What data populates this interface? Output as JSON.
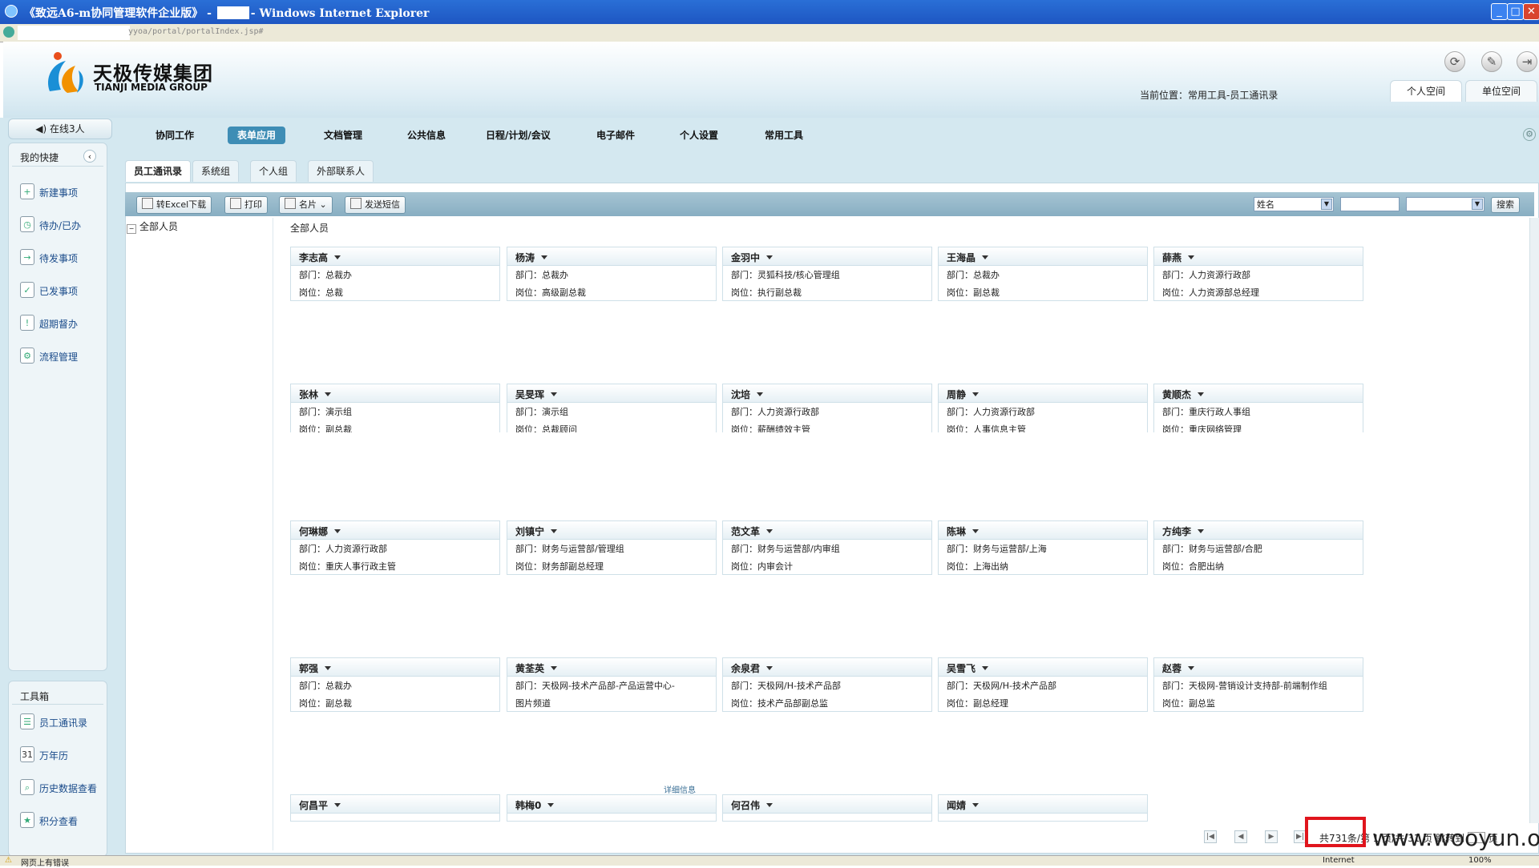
{
  "window": {
    "title": "《致远A6-m协同管理软件企业版》 - ",
    "title_suffix": "- Windows Internet Explorer"
  },
  "address": {
    "url": "yyoa/portal/portalIndex.jsp#"
  },
  "brand": {
    "name_cn": "天极传媒集团",
    "name_en": "TIANJI MEDIA GROUP"
  },
  "header": {
    "location": "当前位置：常用工具-员工通讯录",
    "tabs": [
      "个人空间",
      "单位空间"
    ]
  },
  "sidebar": {
    "online": "在线3人",
    "quick_title": "我的快捷",
    "quick_items": [
      {
        "label": "新建事项",
        "icon": "new-item-icon"
      },
      {
        "label": "待办/已办",
        "icon": "todo-icon"
      },
      {
        "label": "待发事项",
        "icon": "pending-send-icon"
      },
      {
        "label": "已发事项",
        "icon": "sent-icon"
      },
      {
        "label": "超期督办",
        "icon": "overdue-icon"
      },
      {
        "label": "流程管理",
        "icon": "workflow-icon"
      }
    ],
    "toolbox_title": "工具箱",
    "toolbox_items": [
      {
        "label": "员工通讯录",
        "icon": "address-book-icon"
      },
      {
        "label": "万年历",
        "icon": "calendar-icon",
        "glyph": "31"
      },
      {
        "label": "历史数据查看",
        "icon": "history-icon"
      },
      {
        "label": "积分查看",
        "icon": "points-icon"
      }
    ]
  },
  "nav": {
    "items": [
      "协同工作",
      "表单应用",
      "文档管理",
      "公共信息",
      "日程/计划/会议",
      "电子邮件",
      "个人设置",
      "常用工具"
    ],
    "active": "表单应用"
  },
  "subtabs": {
    "items": [
      "员工通讯录",
      "系统组",
      "个人组",
      "外部联系人"
    ],
    "active": "员工通讯录"
  },
  "toolbar": {
    "excel": "转Excel下载",
    "print": "打印",
    "card": "名片",
    "sms": "发送短信",
    "search_field": "姓名",
    "search_button": "搜索"
  },
  "tree": {
    "root": "全部人员"
  },
  "group_label": "全部人员",
  "cards": [
    {
      "name": "李志高",
      "dept": "部门：总裁办",
      "post": "岗位：总裁"
    },
    {
      "name": "杨涛",
      "dept": "部门：总裁办",
      "post": "岗位：高级副总裁"
    },
    {
      "name": "金羽中",
      "dept": "部门：灵狐科技/核心管理组",
      "post": "岗位：执行副总裁"
    },
    {
      "name": "王海晶",
      "dept": "部门：总裁办",
      "post": "岗位：副总裁"
    },
    {
      "name": "薛燕",
      "dept": "部门：人力资源行政部",
      "post": "岗位：人力资源部总经理"
    },
    {
      "name": "张林",
      "dept": "部门：演示组",
      "post": "岗位：副总裁"
    },
    {
      "name": "吴旻珲",
      "dept": "部门：演示组",
      "post": "岗位：总裁顾问"
    },
    {
      "name": "沈培",
      "dept": "部门：人力资源行政部",
      "post": "岗位：薪酬绩效主管"
    },
    {
      "name": "周静",
      "dept": "部门：人力资源行政部",
      "post": "岗位：人事信息主管"
    },
    {
      "name": "黄顺杰",
      "dept": "部门：重庆行政人事组",
      "post": "岗位：重庆网络管理"
    },
    {
      "name": "何琳娜",
      "dept": "部门：人力资源行政部",
      "post": "岗位：重庆人事行政主管"
    },
    {
      "name": "刘镇宁",
      "dept": "部门：财务与运营部/管理组",
      "post": "岗位：财务部副总经理"
    },
    {
      "name": "范文革",
      "dept": "部门：财务与运营部/内审组",
      "post": "岗位：内审会计"
    },
    {
      "name": "陈琳",
      "dept": "部门：财务与运营部/上海",
      "post": "岗位：上海出纳"
    },
    {
      "name": "方纯李",
      "dept": "部门：财务与运营部/合肥",
      "post": "岗位：合肥出纳"
    },
    {
      "name": "郭强",
      "dept": "部门：总裁办",
      "post": "岗位：副总裁"
    },
    {
      "name": "黄荃英",
      "dept": "部门：天极网-技术产品部-产品运营中心-",
      "post": "图片频道"
    },
    {
      "name": "余泉君",
      "dept": "部门：天极网/H-技术产品部",
      "post": "岗位：技术产品部副总监"
    },
    {
      "name": "吴雪飞",
      "dept": "部门：天极网/H-技术产品部",
      "post": "岗位：副总经理"
    },
    {
      "name": "赵蓉",
      "dept": "部门：天极网-营销设计支持部-前端制作组",
      "post": "岗位：副总监"
    },
    {
      "name": "何昌平",
      "dept": "",
      "post": ""
    },
    {
      "name": "韩梅0",
      "dept": "",
      "post": ""
    },
    {
      "name": "何召伟",
      "dept": "",
      "post": ""
    },
    {
      "name": "闻婧",
      "dept": "",
      "post": ""
    }
  ],
  "detail_link": "详细信息",
  "pager": {
    "summary": "共731条/第",
    "pages_text": "1 页/共 31 页",
    "jump_label": "跳转到",
    "page_unit": "页"
  },
  "watermark": "www.wooyun.org",
  "status": {
    "left": "网页上有错误",
    "zone": "Internet",
    "zoom": "100%"
  },
  "colors": {
    "accent": "#3e8db5",
    "toolbar": "#88aec2",
    "highlight": "#e0151d"
  }
}
